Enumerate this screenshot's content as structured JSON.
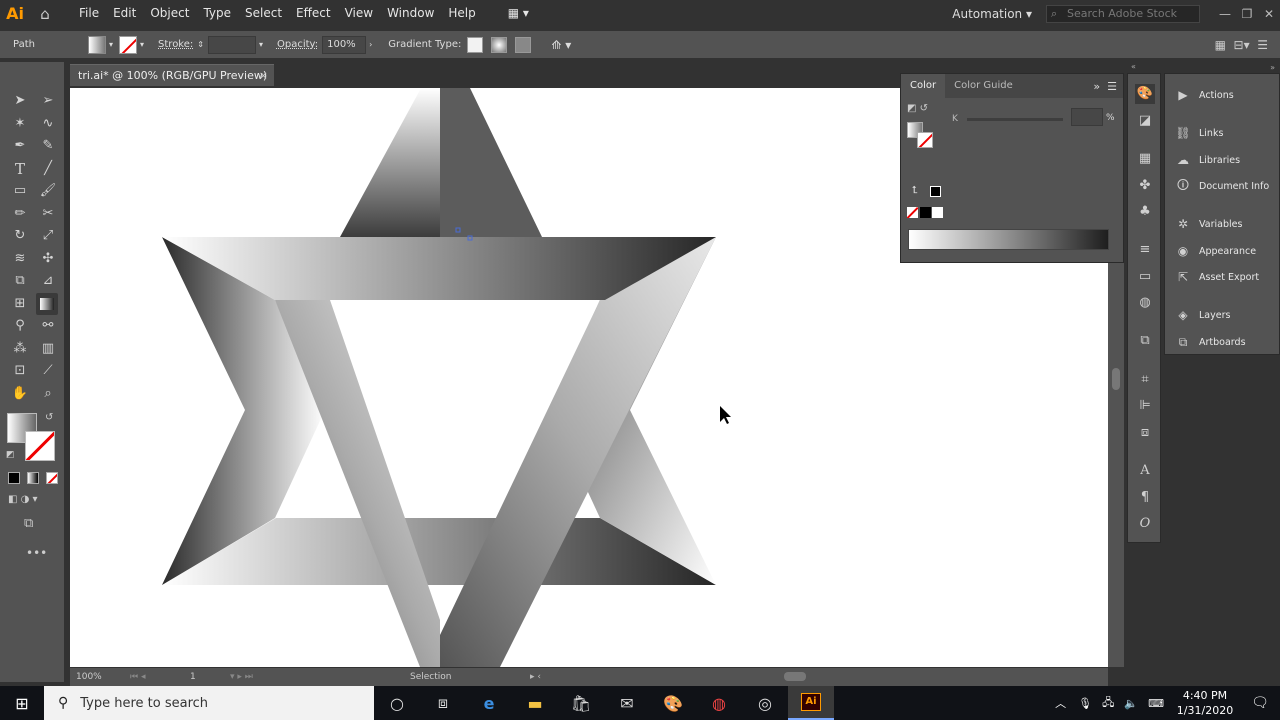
{
  "app": {
    "logo": "Ai",
    "menu": [
      "File",
      "Edit",
      "Object",
      "Type",
      "Select",
      "Effect",
      "View",
      "Window",
      "Help"
    ],
    "workspace": "Automation",
    "search_placeholder": "Search Adobe Stock"
  },
  "control_bar": {
    "selection_type": "Path",
    "stroke_label": "Stroke:",
    "opacity_label": "Opacity:",
    "opacity_value": "100%",
    "gradient_type_label": "Gradient Type:"
  },
  "document": {
    "tab_title": "tri.ai* @ 100% (RGB/GPU Preview)",
    "close_glyph": "×"
  },
  "status_bar": {
    "zoom": "100%",
    "artboard": "1",
    "tool": "Selection"
  },
  "color_panel": {
    "tabs": [
      "Color",
      "Color Guide"
    ],
    "channel_label": "K",
    "percent": "%"
  },
  "right_panel": {
    "items": [
      {
        "icon": "play-icon",
        "label": "Actions"
      },
      {
        "icon": "links-icon",
        "label": "Links"
      },
      {
        "icon": "libraries-icon",
        "label": "Libraries"
      },
      {
        "icon": "info-icon",
        "label": "Document Info"
      },
      {
        "icon": "variables-icon",
        "label": "Variables"
      },
      {
        "icon": "appearance-icon",
        "label": "Appearance"
      },
      {
        "icon": "export-icon",
        "label": "Asset Export"
      },
      {
        "icon": "layers-icon",
        "label": "Layers"
      },
      {
        "icon": "artboards-icon",
        "label": "Artboards"
      }
    ]
  },
  "taskbar": {
    "search_placeholder": "Type here to search",
    "time": "4:40 PM",
    "date": "1/31/2020"
  }
}
